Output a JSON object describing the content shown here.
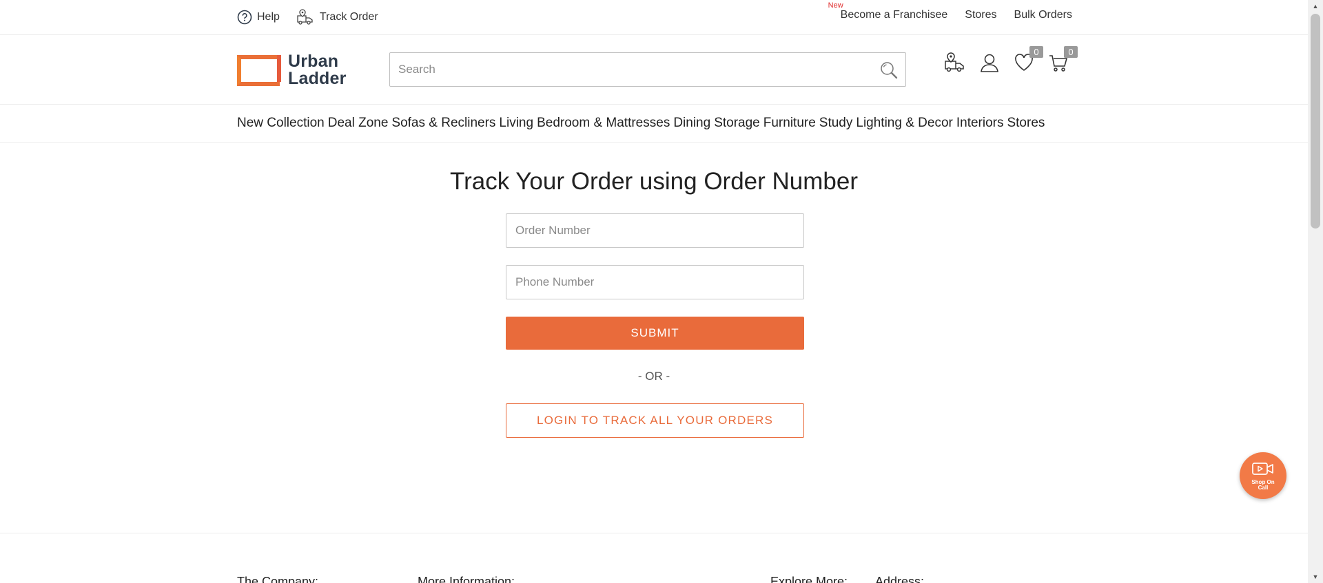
{
  "topbar": {
    "help_label": "Help",
    "track_order_label": "Track Order",
    "new_tag": "New",
    "franchise_label": "Become a Franchisee",
    "stores_label": "Stores",
    "bulk_orders_label": "Bulk Orders"
  },
  "header": {
    "logo_line1": "Urban",
    "logo_line2": "Ladder",
    "search_placeholder": "Search",
    "wishlist_count": "0",
    "cart_count": "0",
    "icons": [
      "track-truck-icon",
      "user-icon",
      "heart-icon",
      "cart-icon"
    ]
  },
  "nav": {
    "items": [
      "New Collection",
      "Deal Zone",
      "Sofas & Recliners",
      "Living",
      "Bedroom & Mattresses",
      "Dining",
      "Storage",
      "Furniture",
      "Study",
      "Lighting & Decor",
      "Interiors",
      "Stores"
    ]
  },
  "main": {
    "title": "Track Your Order using Order Number",
    "order_placeholder": "Order Number",
    "phone_placeholder": "Phone Number",
    "submit_label": "SUBMIT",
    "or_text": "- OR -",
    "login_label": "LOGIN TO TRACK ALL YOUR ORDERS"
  },
  "float_button": {
    "line1": "Shop On",
    "line2": "Call"
  },
  "footer": {
    "headings": [
      "The Company:",
      "More Information:",
      "Explore More:",
      "Address:"
    ]
  },
  "colors": {
    "accent": "#e96b3b",
    "logo_navy": "#2f3b4a",
    "badge_gray": "#999999"
  }
}
